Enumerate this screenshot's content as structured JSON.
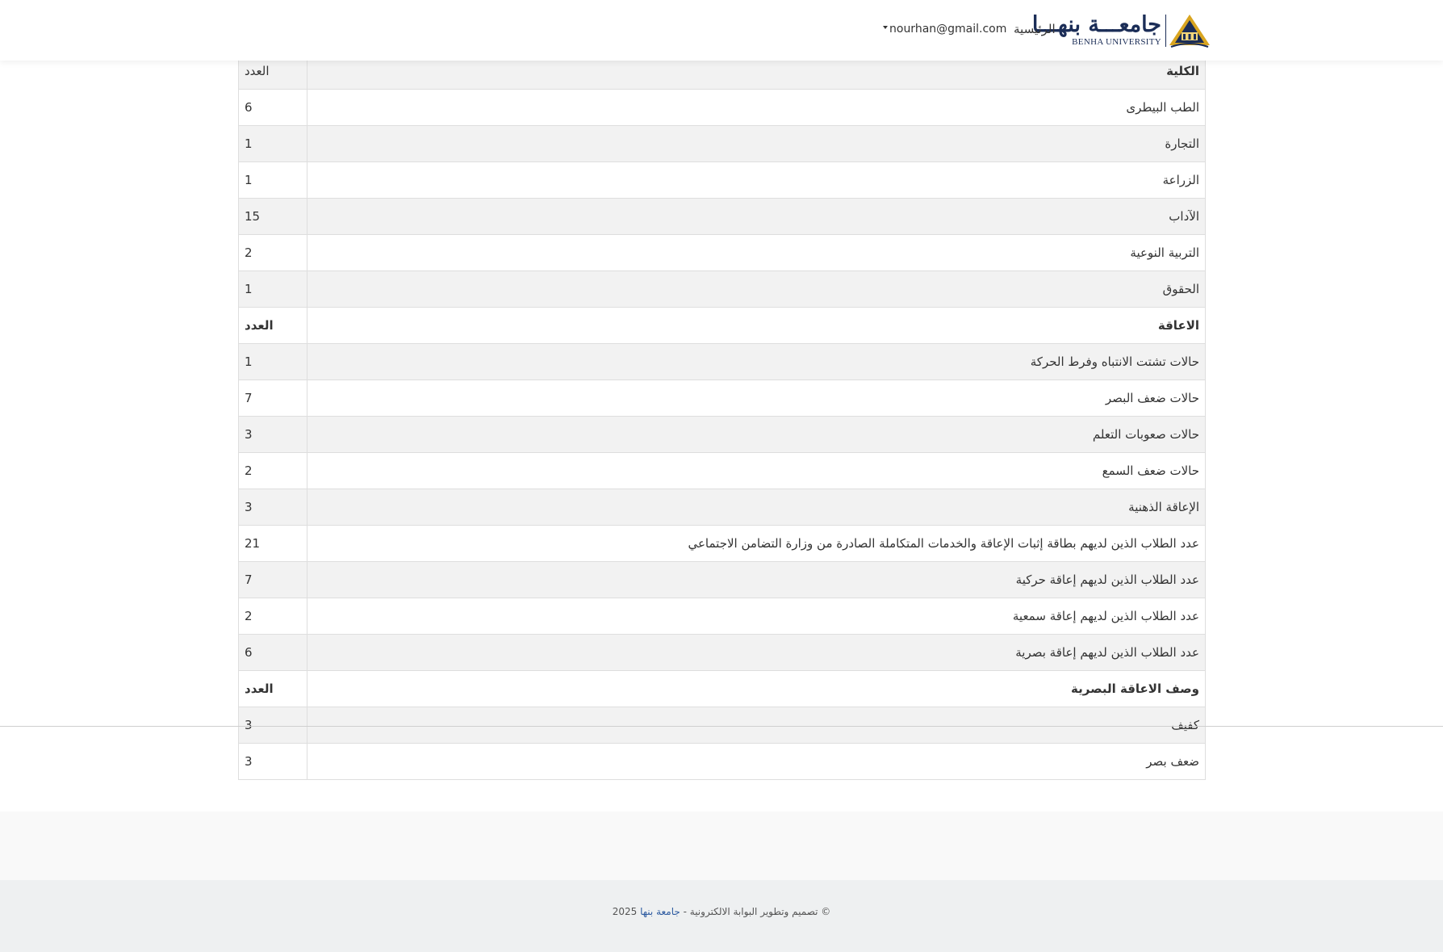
{
  "header": {
    "brand_ar": "جامعـــة بنهـــا",
    "brand_en": "BENHA UNIVERSITY",
    "home_label": "الرئيسية",
    "user_email": "nourhan@gmail.com"
  },
  "colleges": {
    "header": {
      "label": "الكلية",
      "count": "العدد"
    },
    "rows": [
      {
        "label": "الطب البيطرى",
        "count": "6"
      },
      {
        "label": "التجارة",
        "count": "1"
      },
      {
        "label": "الزراعة",
        "count": "1"
      },
      {
        "label": "الآداب",
        "count": "15"
      },
      {
        "label": "التربية النوعية",
        "count": "2"
      },
      {
        "label": "الحقوق",
        "count": "1"
      }
    ]
  },
  "disabilities": {
    "header": {
      "label": "الاعاقة",
      "count": "العدد"
    },
    "rows": [
      {
        "label": "حالات تشتت الانتباه وفرط الحركة",
        "count": "1"
      },
      {
        "label": "حالات ضعف البصر",
        "count": "7"
      },
      {
        "label": "حالات صعوبات التعلم",
        "count": "3"
      },
      {
        "label": "حالات ضعف السمع",
        "count": "2"
      },
      {
        "label": "الإعاقة الذهنية",
        "count": "3"
      },
      {
        "label": "عدد الطلاب الذين لديهم بطاقة إثبات الإعاقة والخدمات المتكاملة الصادرة من وزارة التضامن الاجتماعي",
        "count": "21"
      },
      {
        "label": "عدد الطلاب الذين لديهم إعاقة حركية",
        "count": "7"
      },
      {
        "label": "عدد الطلاب الذين لديهم إعاقة سمعية",
        "count": "2"
      },
      {
        "label": "عدد الطلاب الذين لديهم إعاقة بصرية",
        "count": "6"
      }
    ]
  },
  "visual": {
    "header": {
      "label": "وصف الاعاقة البصرية",
      "count": "العدد"
    },
    "rows": [
      {
        "label": "كفيف",
        "count": "3"
      },
      {
        "label": "ضعف بصر",
        "count": "3"
      }
    ]
  },
  "footer": {
    "prefix": "© تصميم وتطوير البوابة الالكترونية - ",
    "link": "جامعة بنها",
    "year": " 2025"
  },
  "colors": {
    "brand": "#1b2d57",
    "link": "#2c5aa0",
    "row_stripe": "#f2f2f2",
    "footer_bg": "#eef0f1"
  }
}
